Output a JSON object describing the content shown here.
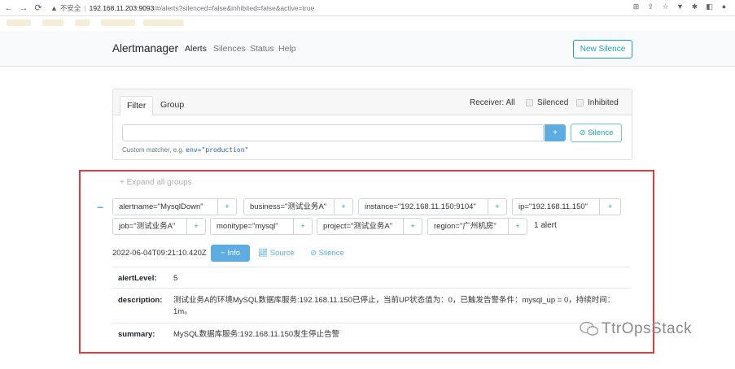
{
  "browser": {
    "insecure_label": "不安全",
    "url_host": "192.168.11.203:9093",
    "url_path": "/#/alerts?silenced=false&inhibited=false&active=true"
  },
  "navbar": {
    "brand": "Alertmanager",
    "links": [
      "Alerts",
      "Silences",
      "Status",
      "Help"
    ],
    "new_silence": "New Silence"
  },
  "filter_card": {
    "tabs": [
      "Filter",
      "Group"
    ],
    "receiver": "Receiver: All",
    "silenced": "Silenced",
    "inhibited": "Inhibited",
    "input_value": "",
    "add_button": "+",
    "silence_button": "Silence",
    "hint_prefix": "Custom matcher, e.g.",
    "hint_example": "env=\"production\""
  },
  "alert_group": {
    "expand_all": "Expand all groups",
    "collapse_symbol": "−",
    "labels": [
      "alertname=\"MysqlDown\"",
      "business=\"测试业务A\"",
      "instance=\"192.168.11.150:9104\"",
      "ip=\"192.168.11.150\"",
      "job=\"测试业务A\"",
      "monitype=\"mysql\"",
      "project=\"测试业务A\"",
      "region=\"广州机房\""
    ],
    "plus": "+",
    "alert_count": "1 alert",
    "timestamp": "2022-06-04T09:21:10.420Z",
    "info_button": "Info",
    "source_link": "Source",
    "silence_link": "Silence",
    "annotations": [
      {
        "key": "alertLevel:",
        "value": "5"
      },
      {
        "key": "description:",
        "value": "测试业务A的环境MySQL数据库服务:192.168.11.150已停止，当前UP状态值为：0，已触发告警条件：mysql_up = 0，持续时间：1m。"
      },
      {
        "key": "summary:",
        "value": "MySQL数据库服务:192.168.11.150发生停止告警"
      }
    ]
  },
  "watermark": "TtrOpsStack"
}
